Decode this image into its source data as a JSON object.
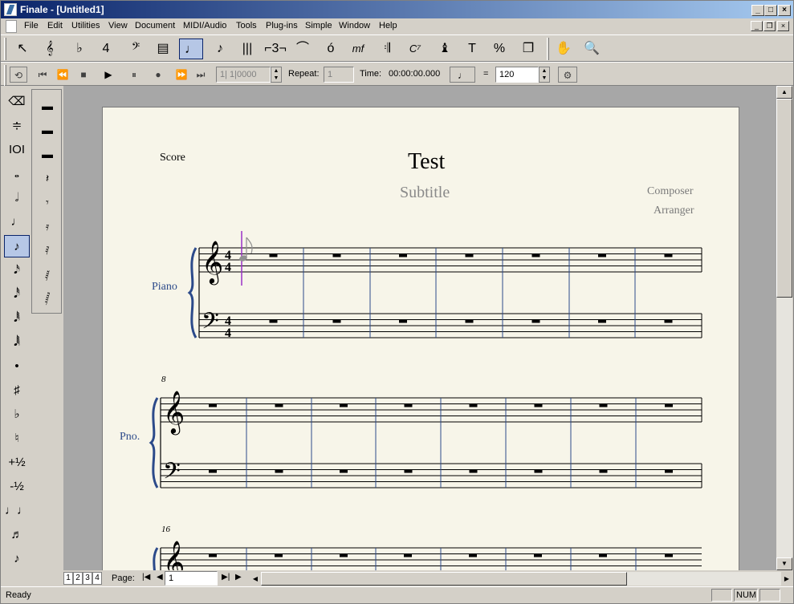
{
  "window": {
    "title": "Finale - [Untitled1]"
  },
  "menu": [
    "File",
    "Edit",
    "Utilities",
    "View",
    "Document",
    "MIDI/Audio",
    "Tools",
    "Plug-ins",
    "Simple",
    "Window",
    "Help"
  ],
  "main_tools": [
    {
      "name": "selection-tool",
      "glyph": "↖"
    },
    {
      "name": "staff-tool",
      "glyph": "𝄞"
    },
    {
      "name": "key-signature-tool",
      "glyph": "♭"
    },
    {
      "name": "time-signature-tool",
      "glyph": "4"
    },
    {
      "name": "clef-tool",
      "glyph": "𝄢"
    },
    {
      "name": "measure-tool",
      "glyph": "▤"
    },
    {
      "name": "simple-entry-tool",
      "glyph": "♩"
    },
    {
      "name": "speedy-entry-tool",
      "glyph": "♪"
    },
    {
      "name": "hyperscribe-tool",
      "glyph": "|||"
    },
    {
      "name": "tuplet-tool",
      "glyph": "⌐3¬"
    },
    {
      "name": "smart-shape-tool",
      "glyph": "⌒"
    },
    {
      "name": "articulation-tool",
      "glyph": "ó"
    },
    {
      "name": "expression-tool",
      "glyph": "mf"
    },
    {
      "name": "repeat-tool",
      "glyph": "𝄇"
    },
    {
      "name": "chord-tool",
      "glyph": "C⁷"
    },
    {
      "name": "lyrics-tool",
      "glyph": "♝"
    },
    {
      "name": "text-tool",
      "glyph": "T"
    },
    {
      "name": "resize-tool",
      "glyph": "%"
    },
    {
      "name": "page-layout-tool",
      "glyph": "❐"
    },
    {
      "name": "hand-grabber-tool",
      "glyph": "✋"
    },
    {
      "name": "zoom-tool",
      "glyph": "🔍"
    }
  ],
  "playback": {
    "position": "1| 1|0000",
    "repeat_label": "Repeat:",
    "repeat_value": "1",
    "time_label": "Time:",
    "time_value": "00:00:00.000",
    "equals": "=",
    "tempo": "120"
  },
  "simple_palette": [
    "⌫",
    "≑",
    "IOI",
    "𝅝",
    "𝅗𝅥",
    "♩",
    "♪",
    "𝅘𝅥𝅯",
    "𝅘𝅥𝅰",
    "𝅘𝅥𝅱",
    "𝅘𝅥𝅲",
    "•",
    "♯",
    "♭",
    "♮",
    "+½",
    "-½",
    "♩♩",
    "♬",
    "♪"
  ],
  "rest_palette": [
    "▬",
    "▬",
    "▬",
    "𝄽",
    "𝄾",
    "𝄿",
    "𝅀",
    "𝅁",
    "𝅂"
  ],
  "score": {
    "label": "Score",
    "title": "Test",
    "subtitle": "Subtitle",
    "composer": "Composer",
    "arranger": "Arranger",
    "instrument_full": "Piano",
    "instrument_short": "Pno.",
    "time_top": "4",
    "time_bottom": "4",
    "system2_measure": "8",
    "system3_measure": "16"
  },
  "pages": {
    "tabs": [
      "1",
      "2",
      "3",
      "4"
    ],
    "label": "Page:",
    "current": "1"
  },
  "status": {
    "text": "Ready",
    "num": "NUM"
  },
  "colors": {
    "accent": "#0a246a",
    "paper": "#f7f5e9",
    "selection": "#b6c7e6",
    "barline": "#2c4a8a",
    "caret": "#9b30c8"
  }
}
